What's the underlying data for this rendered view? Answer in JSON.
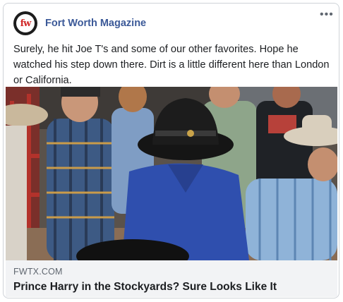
{
  "post": {
    "page_name": "Fort Worth Magazine",
    "avatar_text": "fw",
    "more_icon": "•••",
    "caption": "Surely, he hit Joe T's and some of our other favorites. Hope he watched his step down there. Dirt is a little different here than London or California."
  },
  "link_preview": {
    "domain": "FWTX.COM",
    "headline": "Prince Harry in the Stockyards? Sure Looks Like It"
  },
  "colors": {
    "page_name": "#3b5998",
    "link_bg": "#f2f3f5",
    "avatar_accent": "#d12a2a"
  }
}
